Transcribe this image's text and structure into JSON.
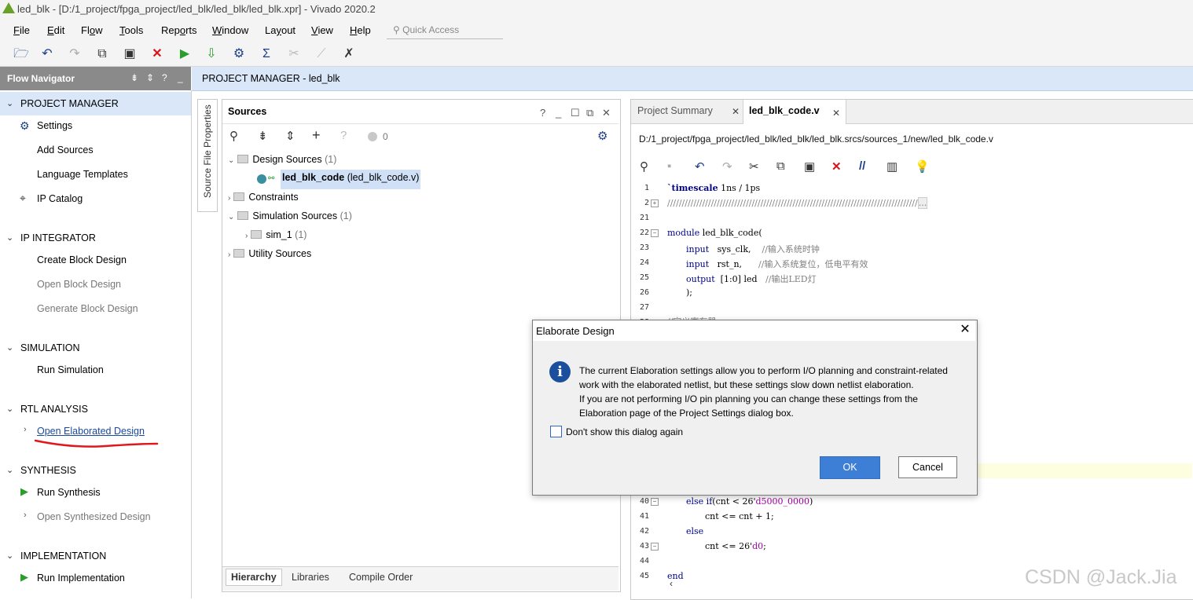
{
  "window": {
    "title": "led_blk - [D:/1_project/fpga_project/led_blk/led_blk/led_blk.xpr] - Vivado 2020.2"
  },
  "menu": {
    "items": [
      {
        "u": "F",
        "rest": "ile"
      },
      {
        "u": "E",
        "rest": "dit"
      },
      {
        "pre": "Fl",
        "u": "o",
        "rest": "w"
      },
      {
        "u": "T",
        "rest": "ools"
      },
      {
        "pre": "Rep",
        "u": "o",
        "rest": "rts"
      },
      {
        "u": "W",
        "rest": "indow"
      },
      {
        "pre": "La",
        "u": "y",
        "rest": "out"
      },
      {
        "u": "V",
        "rest": "iew"
      },
      {
        "u": "H",
        "rest": "elp"
      }
    ],
    "quick_access_placeholder": "Quick Access"
  },
  "toolbar": {
    "icons": [
      "open-project-icon",
      "undo-icon",
      "redo-icon",
      "copy-icon",
      "paste-icon",
      "delete-icon",
      "run-icon",
      "program-device-icon",
      "settings-icon",
      "sigma-icon",
      "disabled-tool-icon",
      "disabled-tool-icon-2",
      "wand-icon"
    ]
  },
  "flow_navigator": {
    "title": "Flow Navigator",
    "sections": {
      "project_manager": "PROJECT MANAGER",
      "ip_integrator": "IP INTEGRATOR",
      "simulation": "SIMULATION",
      "rtl_analysis": "RTL ANALYSIS",
      "synthesis": "SYNTHESIS",
      "implementation": "IMPLEMENTATION"
    },
    "items": {
      "settings": "Settings",
      "add_sources": "Add Sources",
      "language_templates": "Language Templates",
      "ip_catalog": "IP Catalog",
      "create_block_design": "Create Block Design",
      "open_block_design": "Open Block Design",
      "generate_block_design": "Generate Block Design",
      "run_simulation": "Run Simulation",
      "open_elaborated_design": "Open Elaborated Design",
      "run_synthesis": "Run Synthesis",
      "open_synthesized_design": "Open Synthesized Design",
      "run_implementation": "Run Implementation"
    }
  },
  "project_header": {
    "title": "PROJECT MANAGER - led_blk"
  },
  "side_tab": {
    "label": "Source File Properties"
  },
  "sources": {
    "title": "Sources",
    "count": "0",
    "tree": {
      "design_sources": "Design Sources",
      "design_sources_count": "(1)",
      "top_module": "led_blk_code",
      "top_module_file": "(led_blk_code.v)",
      "constraints": "Constraints",
      "simulation_sources": "Simulation Sources",
      "simulation_sources_count": "(1)",
      "sim_1": "sim_1",
      "sim_1_count": "(1)",
      "utility_sources": "Utility Sources"
    },
    "tabs": {
      "hierarchy": "Hierarchy",
      "libraries": "Libraries",
      "compile_order": "Compile Order"
    }
  },
  "editor": {
    "tabs": {
      "summary": "Project Summary",
      "file": "led_blk_code.v"
    },
    "path": "D:/1_project/fpga_project/led_blk/led_blk/led_blk.srcs/sources_1/new/led_blk_code.v",
    "line_numbers": [
      "1",
      "2",
      "21",
      "22",
      "23",
      "24",
      "25",
      "26",
      "27",
      "28",
      "40",
      "41",
      "42",
      "43",
      "44",
      "45"
    ],
    "code": {
      "l1_kw": "`timescale",
      "l1_rest": " 1ns / 1ps",
      "l2": "//////////////////////////////////////////////////////////////////////////////////////",
      "l2_fold": "...",
      "l22_kw": "module",
      "l22_rest": " led_blk_code(",
      "l23_kw": "input",
      "l23_mid": "   sys_clk,    ",
      "l23_cm": "//输入系统时钟",
      "l24_kw": "input",
      "l24_mid": "   rst_n,      ",
      "l24_cm": "//输入系统复位，低电平有效",
      "l25_kw": "output",
      "l25_mid": "  [1:0] led   ",
      "l25_cm": "//输出LED灯",
      "l26": ");",
      "l28_cm": "//定义寄存器",
      "l40_kw": "else if",
      "l40_mid": "(cnt < 26'",
      "l40_num": "d5000_0000",
      "l40_end": ")",
      "l41": "cnt <= cnt + 1;",
      "l42_kw": "else",
      "l43_pre": "cnt <= 26'",
      "l43_num": "d0",
      "l43_end": ";",
      "l45_kw": "end"
    }
  },
  "dialog": {
    "title": "Elaborate Design",
    "lines": [
      "The current Elaboration settings allow you to perform I/O planning and constraint-related",
      "work with the elaborated netlist, but these settings slow down netlist elaboration.",
      "If you are not performing I/O pin planning you can change these settings from the",
      "Elaboration page of the Project Settings dialog box."
    ],
    "checkbox_label": "Don't show this dialog again",
    "ok": "OK",
    "cancel": "Cancel"
  },
  "watermark": "CSDN @Jack.Jia",
  "colors": {
    "accent": "#3d7fd6",
    "header_blue": "#d9e7f9",
    "run_green": "#2a9d2a",
    "delete_red": "#d9141b",
    "annotation_red": "#e0181e"
  }
}
